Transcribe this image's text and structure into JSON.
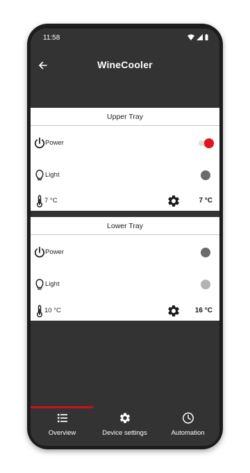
{
  "status_bar": {
    "time": "11:58"
  },
  "app_bar": {
    "title": "WineCooler"
  },
  "trays": [
    {
      "title": "Upper Tray",
      "power": {
        "label": "Power",
        "on": true
      },
      "light": {
        "label": "Light",
        "on": false
      },
      "current_temp": "7 °C",
      "target_temp": "7 °C"
    },
    {
      "title": "Lower Tray",
      "power": {
        "label": "Power",
        "on": false
      },
      "light": {
        "label": "Light",
        "on": false
      },
      "current_temp": "10 °C",
      "target_temp": "16 °C"
    }
  ],
  "bottom_nav": {
    "items": [
      {
        "label": "Overview",
        "icon": "list-icon",
        "active": true
      },
      {
        "label": "Device settings",
        "icon": "gear-icon",
        "active": false
      },
      {
        "label": "Automation",
        "icon": "clock-icon",
        "active": false
      }
    ]
  },
  "colors": {
    "accent": "#e3141b",
    "background": "#333333",
    "card": "#ffffff"
  }
}
